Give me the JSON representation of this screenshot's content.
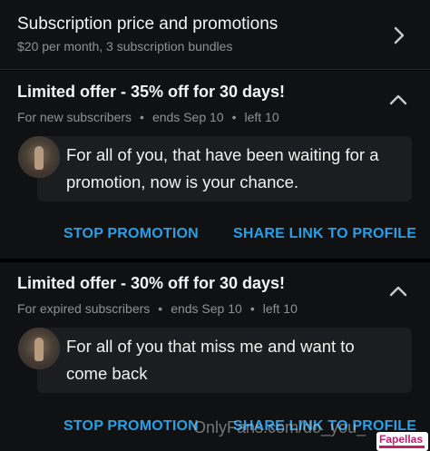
{
  "subscription": {
    "title": "Subscription price and promotions",
    "subtitle": "$20 per month, 3 subscription bundles",
    "icon": "chevron-right-icon"
  },
  "promotions": [
    {
      "title": "Limited offer - 35% off for 30 days!",
      "audience": "For new subscribers",
      "ends": "ends Sep 10",
      "left": "left 10",
      "message": "For all of you, that have been waiting for a promotion, now is your chance.",
      "stop_label": "STOP PROMOTION",
      "share_label": "SHARE LINK TO PROFILE",
      "icon": "chevron-up-icon"
    },
    {
      "title": "Limited offer - 30% off for 30 days!",
      "audience": "For expired subscribers",
      "ends": "ends Sep 10",
      "left": "left 10",
      "message": "For all of you that miss me and want to come back",
      "stop_label": "STOP PROMOTION",
      "share_label": "SHARE LINK TO PROFILE",
      "icon": "chevron-up-icon"
    }
  ],
  "separator": "•",
  "watermark": "OnlyFans.com/do_you_",
  "badge": "Fapellas",
  "colors": {
    "accent": "#2c9ee3",
    "background": "#000000",
    "card": "#101113",
    "bubble": "#1c1d20",
    "muted_text": "#8e9196"
  }
}
